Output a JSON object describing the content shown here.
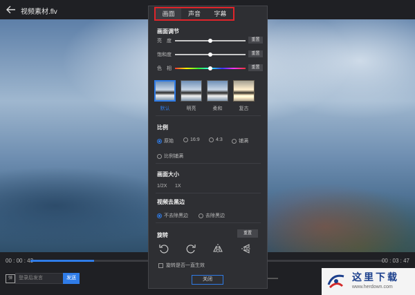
{
  "window": {
    "title": "视频素材.flv"
  },
  "player": {
    "time_current": "00 : 00 : 43",
    "time_total": "00 : 03 : 47",
    "progress": 0.18,
    "danmu_icon_text": "弹",
    "danmu_placeholder": "登录后发言",
    "send_label": "发送"
  },
  "panel": {
    "tabs": [
      {
        "label": "画面",
        "active": true
      },
      {
        "label": "声音",
        "active": false
      },
      {
        "label": "字幕",
        "active": false
      }
    ],
    "picture_adjust": {
      "title": "画面调节",
      "rows": [
        {
          "label": "亮　度",
          "value": 0.5,
          "reset": "重置"
        },
        {
          "label": "饱和度",
          "value": 0.5,
          "reset": "重置"
        },
        {
          "label": "色　相",
          "value": 0.5,
          "reset": "重置"
        }
      ]
    },
    "filters": [
      {
        "label": "默认",
        "selected": true
      },
      {
        "label": "明亮",
        "selected": false
      },
      {
        "label": "柔和",
        "selected": false
      },
      {
        "label": "复古",
        "selected": false
      }
    ],
    "ratio": {
      "title": "比例",
      "options": [
        {
          "label": "原始",
          "selected": true
        },
        {
          "label": "16:9",
          "selected": false
        },
        {
          "label": "4:3",
          "selected": false
        },
        {
          "label": "铺满",
          "selected": false
        },
        {
          "label": "比例铺满",
          "selected": false
        }
      ]
    },
    "size": {
      "title": "画面大小",
      "options": [
        "1/2X",
        "1X"
      ]
    },
    "black_border": {
      "title": "视频去黑边",
      "options": [
        {
          "label": "不去除黑边",
          "selected": true
        },
        {
          "label": "去除黑边",
          "selected": false
        }
      ]
    },
    "rotate": {
      "title": "旋转",
      "reset": "重置",
      "icons": [
        "rotate-left-icon",
        "rotate-right-icon",
        "flip-horizontal-icon",
        "flip-vertical-icon"
      ],
      "always_apply_label": "旋转是否一直生效",
      "always_apply": false
    },
    "close_label": "关闭"
  },
  "watermark": {
    "text": "这里下载",
    "url": "www.herdown.com"
  },
  "colors": {
    "accent": "#2f7ce8",
    "highlight_border": "#e0242a"
  }
}
